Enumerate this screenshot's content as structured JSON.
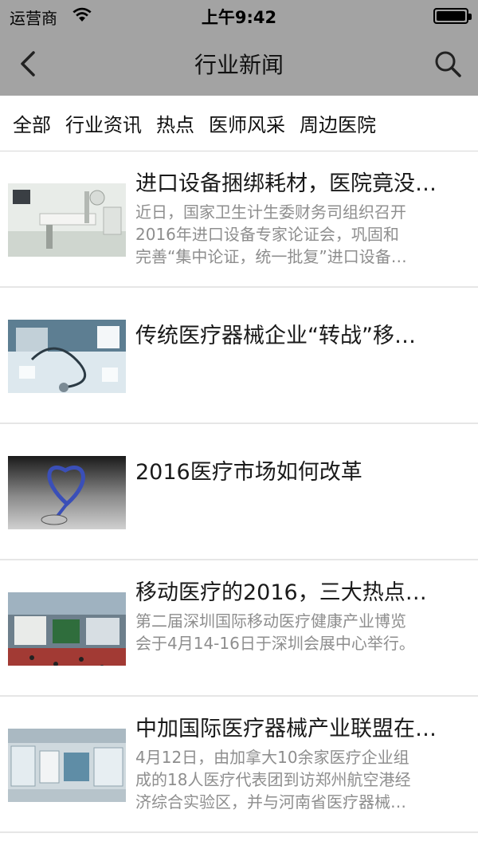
{
  "status_bar": {
    "carrier": "运营商",
    "time": "上午9:42"
  },
  "nav": {
    "title": "行业新闻",
    "back_icon": "chevron-left-icon",
    "search_icon": "search-icon"
  },
  "tabs": [
    {
      "label": "全部"
    },
    {
      "label": "行业资讯"
    },
    {
      "label": "热点"
    },
    {
      "label": "医师风采"
    },
    {
      "label": "周边医院"
    }
  ],
  "news": [
    {
      "title": "进口设备捆绑耗材，医院竟没…",
      "desc": [
        "近日，国家卫生计生委财务司组织召开",
        "2016年进口设备专家论证会，巩固和",
        "完善“集中论证，统一批复”进口设备…"
      ]
    },
    {
      "title": "传统医疗器械企业“转战”移…",
      "desc": []
    },
    {
      "title": "2016医疗市场如何改革",
      "desc": []
    },
    {
      "title": "移动医疗的2016，三大热点…",
      "desc": [
        "第二届深圳国际移动医疗健康产业博览",
        "会于4月14-16日于深圳会展中心举行。"
      ]
    },
    {
      "title": "中加国际医疗器械产业联盟在…",
      "desc": [
        " 4月12日，由加拿大10余家医疗企业组",
        "成的18人医疗代表团到访郑州航空港经",
        "济综合实验区，并与河南省医疗器械…"
      ]
    }
  ]
}
